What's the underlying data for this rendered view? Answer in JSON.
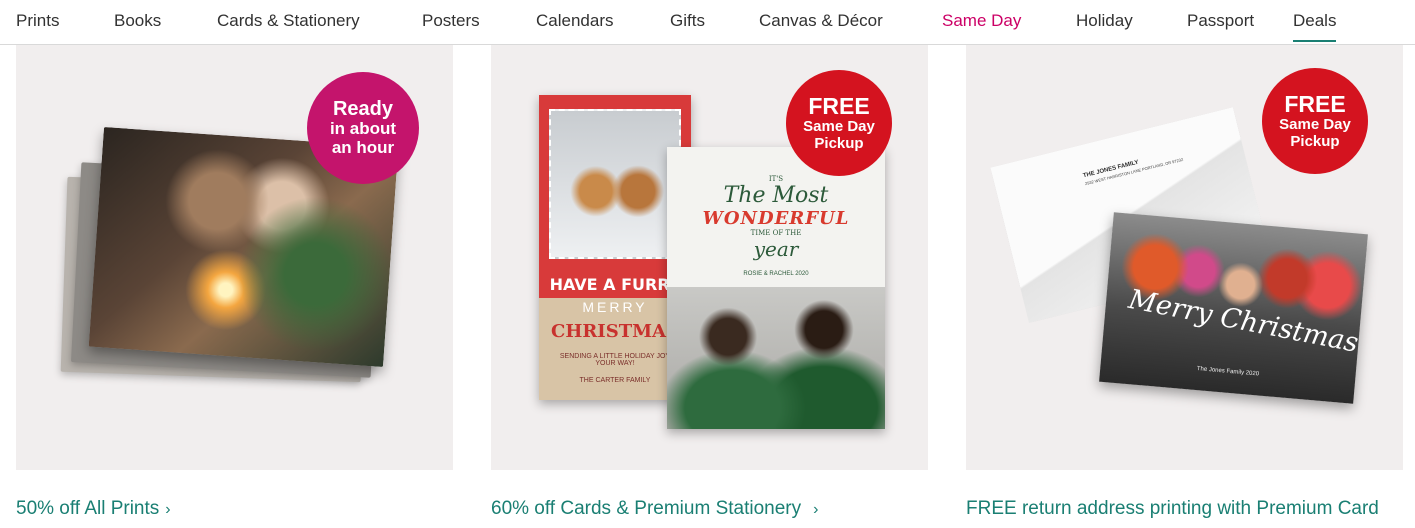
{
  "nav": {
    "items": [
      {
        "label": "Prints"
      },
      {
        "label": "Books"
      },
      {
        "label": "Cards & Stationery"
      },
      {
        "label": "Posters"
      },
      {
        "label": "Calendars"
      },
      {
        "label": "Gifts"
      },
      {
        "label": "Canvas & Décor"
      },
      {
        "label": "Same Day"
      },
      {
        "label": "Holiday"
      },
      {
        "label": "Passport"
      },
      {
        "label": "Deals"
      }
    ],
    "highlight_color": "#cc0066",
    "active_underline_color": "#1a7f73"
  },
  "promos": [
    {
      "badge": {
        "line1": "Ready",
        "line2": "in about",
        "line3": "an hour",
        "color": "#c4146c"
      },
      "link": "50% off All Prints",
      "chevron": "›"
    },
    {
      "badge": {
        "line1": "FREE",
        "line2": "Same Day",
        "line3": "Pickup",
        "color": "#d4131f"
      },
      "card_text": {
        "furry": "HAVE A FURRY",
        "merry": "MERRY",
        "christmas": "CHRISTMAS",
        "sending": "SENDING A LITTLE HOLIDAY JOY YOUR WAY!",
        "family": "THE CARTER FAMILY",
        "its": "IT'S",
        "the_most": "The Most",
        "wonderful": "WONDERFUL",
        "time_of": "TIME OF THE",
        "year": "year",
        "names": "ROSIE & RACHEL 2020"
      },
      "link": "60% off Cards & Premium Stationery",
      "chevron": "›"
    },
    {
      "badge": {
        "line1": "FREE",
        "line2": "Same Day",
        "line3": "Pickup",
        "color": "#d4131f"
      },
      "card_text": {
        "return_name": "THE JONES FAMILY",
        "return_addr": "2932 WEST HARRISTON LANE PORTLAND, OR 97232",
        "merry_christmas": "Merry Christmas",
        "family": "The Jones Family 2020"
      },
      "link": "FREE return address printing with Premium Card"
    }
  ],
  "colors": {
    "link": "#1a7f73",
    "card_bg": "#f1eeee"
  }
}
